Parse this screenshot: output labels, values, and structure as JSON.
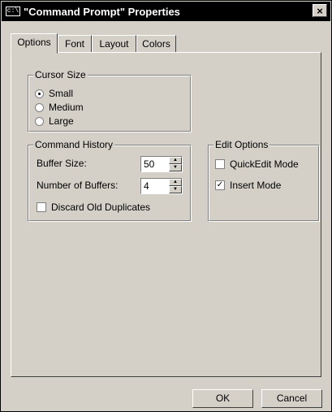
{
  "window": {
    "title": "\"Command Prompt\" Properties",
    "close_label": "×",
    "icon_text": "c:\\"
  },
  "tabs": [
    {
      "label": "Options",
      "active": true
    },
    {
      "label": "Font",
      "active": false
    },
    {
      "label": "Layout",
      "active": false
    },
    {
      "label": "Colors",
      "active": false
    }
  ],
  "cursor_size": {
    "title": "Cursor Size",
    "options": [
      {
        "label": "Small",
        "selected": true
      },
      {
        "label": "Medium",
        "selected": false
      },
      {
        "label": "Large",
        "selected": false
      }
    ]
  },
  "command_history": {
    "title": "Command History",
    "buffer_size_label": "Buffer Size:",
    "buffer_size_value": "50",
    "buffers_label": "Number of Buffers:",
    "buffers_value": "4",
    "discard_label": "Discard Old Duplicates",
    "discard_checked": false
  },
  "edit_options": {
    "title": "Edit Options",
    "quickedit_label": "QuickEdit Mode",
    "quickedit_checked": false,
    "insert_label": "Insert Mode",
    "insert_checked": true,
    "check_mark": "✓"
  },
  "buttons": {
    "ok": "OK",
    "cancel": "Cancel"
  },
  "icons": {
    "spin_up": "▲",
    "spin_down": "▼"
  }
}
